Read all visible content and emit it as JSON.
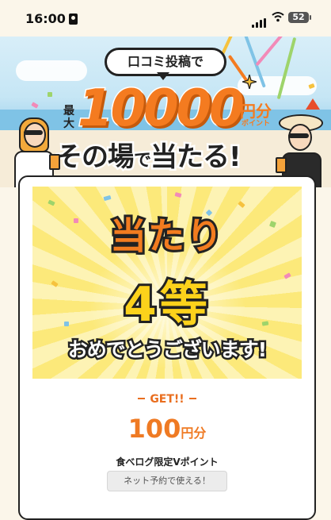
{
  "status_bar": {
    "time": "16:00",
    "battery": "52"
  },
  "banner": {
    "bubble": "口コミ投稿で",
    "max_label": "最大",
    "amount": "10000",
    "unit": "円分",
    "unit_sub": "ポイント",
    "headline_1": "その場",
    "headline_2": "で",
    "headline_3": "当たる!"
  },
  "prize": {
    "title": "当たり",
    "rank": "4等",
    "message": "おめでとうございます!"
  },
  "reward": {
    "get_label": "GET!!",
    "amount": "100",
    "unit": "円分",
    "point_type": "食べログ限定Vポイント",
    "button": "ネット予約で使える！"
  },
  "colors": {
    "accent": "#f47b20",
    "gold": "#fcd21b",
    "dark": "#222222"
  }
}
